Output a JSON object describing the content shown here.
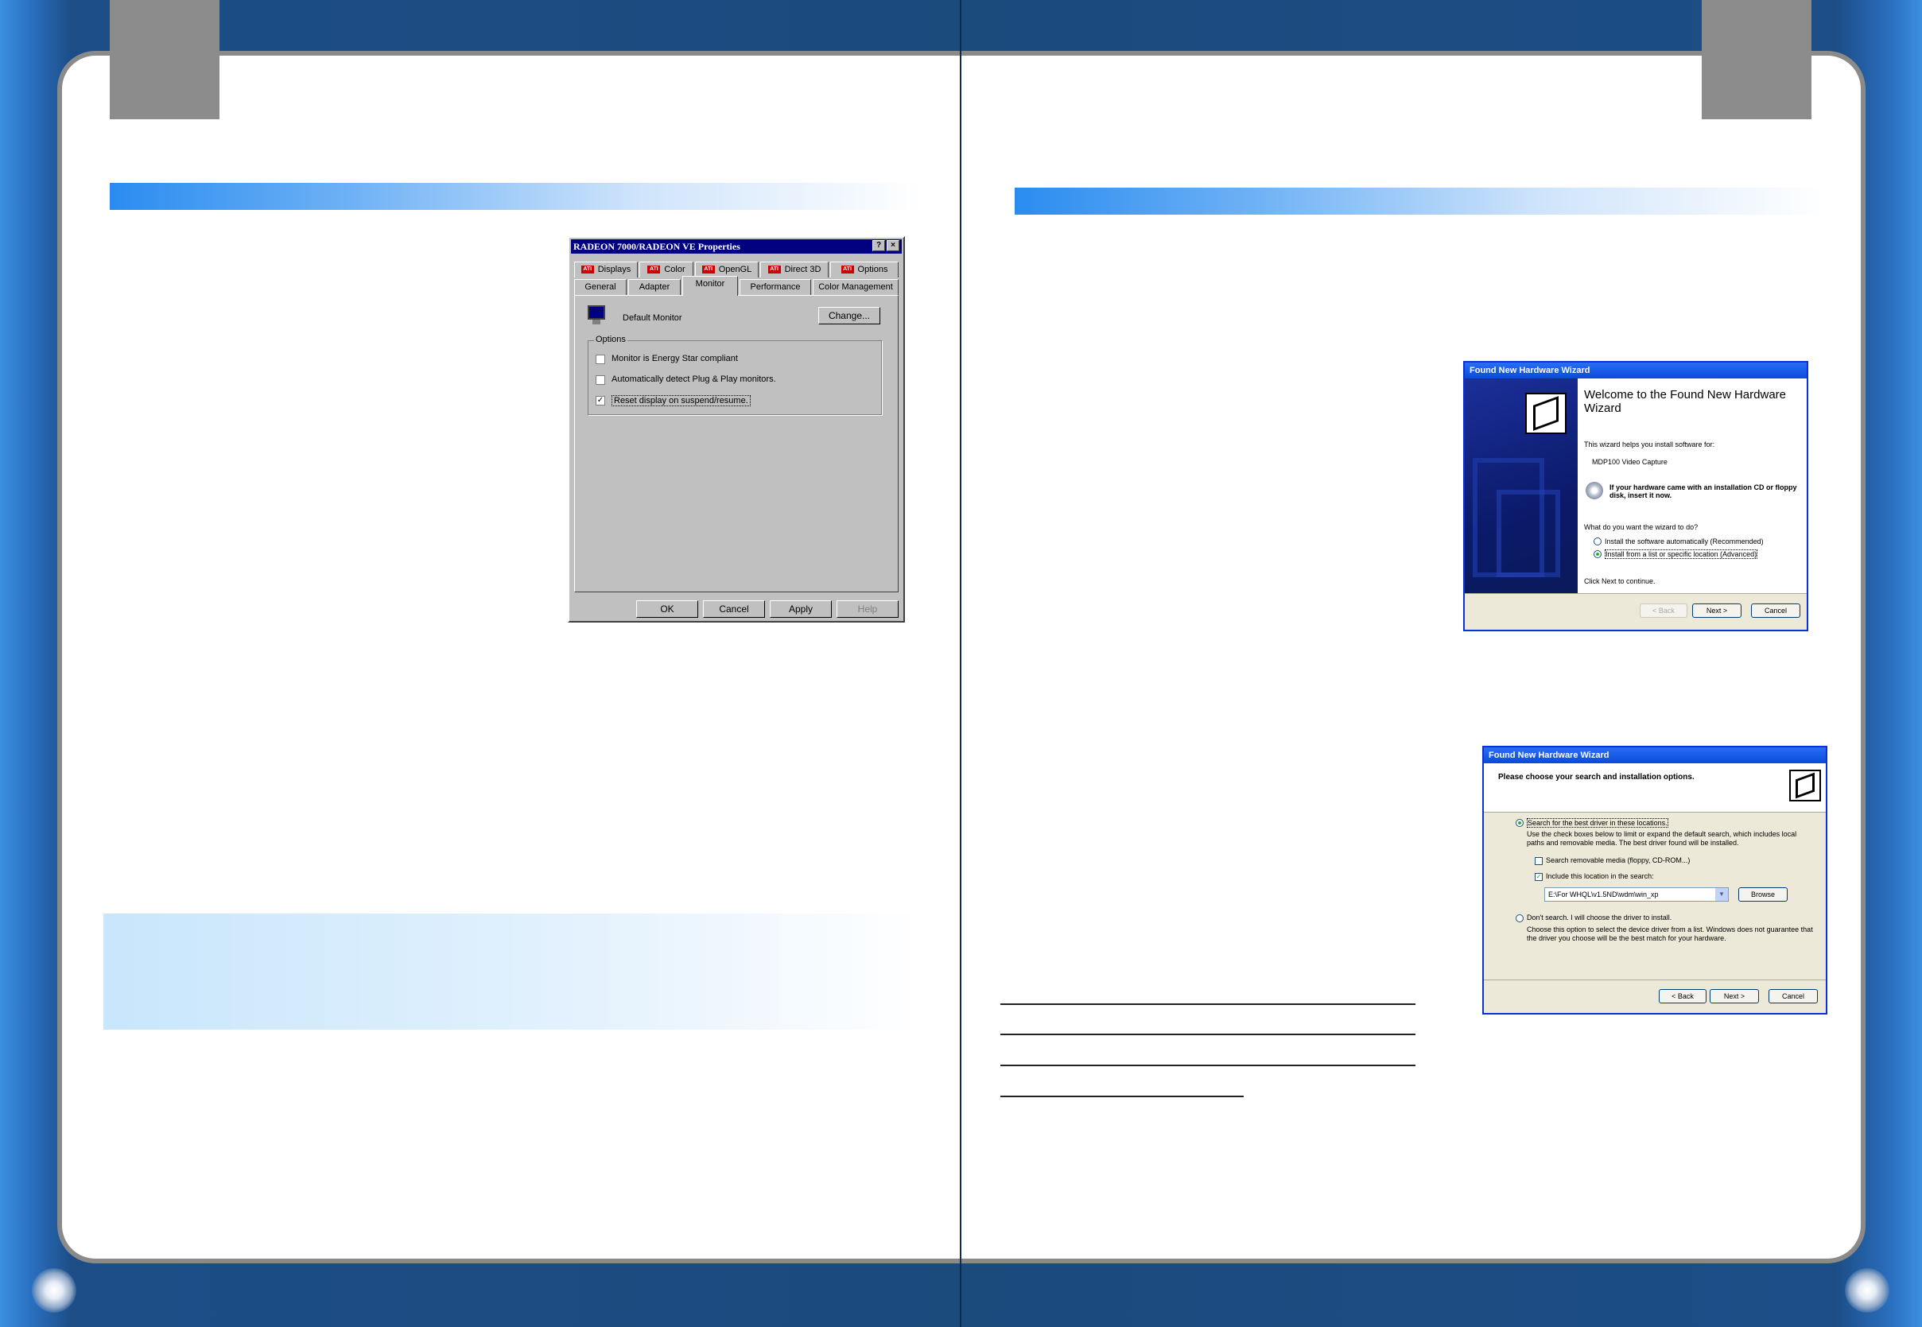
{
  "dialog98": {
    "title": "RADEON 7000/RADEON VE  Properties",
    "help_btn": "?",
    "close_btn": "×",
    "top_tabs": [
      "Displays",
      "Color",
      "OpenGL",
      "Direct 3D",
      "Options"
    ],
    "bottom_tabs": [
      "General",
      "Adapter",
      "Monitor",
      "Performance",
      "Color Management"
    ],
    "ati_badge": "ATI",
    "monitor_name": "Default Monitor",
    "change_btn": "Change...",
    "options_group": "Options",
    "opt1": "Monitor is Energy Star compliant",
    "opt2": "Automatically detect Plug & Play monitors.",
    "opt3": "Reset display on suspend/resume.",
    "opt3_mark": "✓",
    "ok": "OK",
    "cancel": "Cancel",
    "apply": "Apply",
    "help": "Help"
  },
  "wizard1": {
    "title": "Found New Hardware Wizard",
    "heading": "Welcome to the Found New Hardware Wizard",
    "helps": "This wizard helps you install software for:",
    "device": "MDP100 Video Capture",
    "cd_note": "If your hardware came with an installation CD or floppy disk, insert it now.",
    "question": "What do you want the wizard to do?",
    "radio1": "Install the software automatically (Recommended)",
    "radio2": "Install from a list or specific location (Advanced)",
    "click_next": "Click Next to continue.",
    "back": "< Back",
    "next": "Next >",
    "cancel": "Cancel"
  },
  "wizard2": {
    "title": "Found New Hardware Wizard",
    "heading": "Please choose your search and installation options.",
    "radio1": "Search for the best driver in these locations.",
    "radio1_desc1": "Use the check boxes below to limit or expand the default search, which includes local",
    "radio1_desc2": "paths and removable media. The best driver found will be installed.",
    "chk1": "Search removable media (floppy, CD-ROM...)",
    "chk2": "Include this location in the search:",
    "chk_mark": "✓",
    "path": "E:\\For WHQL\\v1.5ND\\wdm\\win_xp",
    "browse": "Browse",
    "radio2": "Don't search. I will choose the driver to install.",
    "radio2_desc1": "Choose this option to select the device driver from a list. Windows does not guarantee that",
    "radio2_desc2": "the driver you choose will be the best match for your hardware.",
    "back": "< Back",
    "next": "Next >",
    "cancel": "Cancel"
  }
}
